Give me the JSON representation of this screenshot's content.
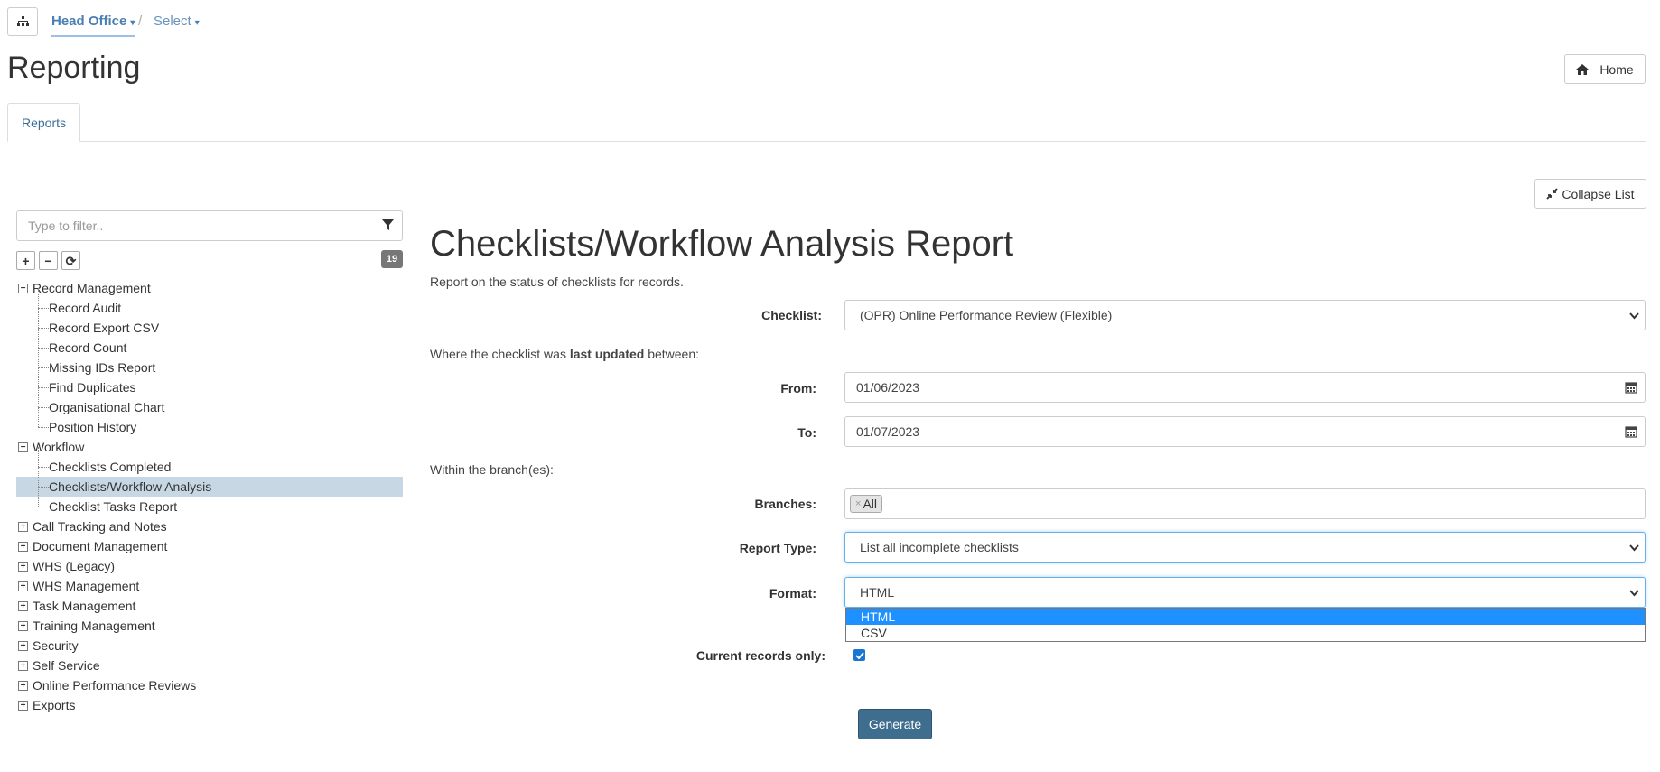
{
  "breadcrumb": {
    "org_icon": "sitemap-icon",
    "current": "Head Office",
    "separator": "/",
    "select_label": "Select",
    "caret": "▾"
  },
  "page": {
    "title": "Reporting",
    "home_label": "Home",
    "home_icon": "home-icon"
  },
  "tabs": [
    {
      "label": "Reports",
      "active": true
    }
  ],
  "sidebar": {
    "collapse_label": "Collapse List",
    "filter_placeholder": "Type to filter..",
    "count": "19",
    "tools": [
      "+",
      "−",
      "⟳"
    ],
    "tree": [
      {
        "label": "Record Management",
        "expanded": true,
        "children": [
          {
            "label": "Record Audit"
          },
          {
            "label": "Record Export CSV"
          },
          {
            "label": "Record Count"
          },
          {
            "label": "Missing IDs Report"
          },
          {
            "label": "Find Duplicates"
          },
          {
            "label": "Organisational Chart"
          },
          {
            "label": "Position History"
          }
        ]
      },
      {
        "label": "Workflow",
        "expanded": true,
        "children": [
          {
            "label": "Checklists Completed"
          },
          {
            "label": "Checklists/Workflow Analysis",
            "selected": true
          },
          {
            "label": "Checklist Tasks Report"
          }
        ]
      },
      {
        "label": "Call Tracking and Notes",
        "expanded": false
      },
      {
        "label": "Document Management",
        "expanded": false
      },
      {
        "label": "WHS (Legacy)",
        "expanded": false
      },
      {
        "label": "WHS Management",
        "expanded": false
      },
      {
        "label": "Task Management",
        "expanded": false
      },
      {
        "label": "Training Management",
        "expanded": false
      },
      {
        "label": "Security",
        "expanded": false
      },
      {
        "label": "Self Service",
        "expanded": false
      },
      {
        "label": "Online Performance Reviews",
        "expanded": false
      },
      {
        "label": "Exports",
        "expanded": false
      }
    ]
  },
  "report": {
    "title": "Checklists/Workflow Analysis Report",
    "description": "Report on the status of checklists for records.",
    "checklist_label": "Checklist:",
    "checklist_value": "(OPR) Online Performance Review (Flexible)",
    "last_updated_pre": "Where the checklist was ",
    "last_updated_bold": "last updated",
    "last_updated_post": " between:",
    "from_label": "From:",
    "from_value": "01/06/2023",
    "to_label": "To:",
    "to_value": "01/07/2023",
    "branch_text": "Within the branch(es):",
    "branches_label": "Branches:",
    "branch_tag": "All",
    "branch_tag_remove": "×",
    "report_type_label": "Report Type:",
    "report_type_value": "List all incomplete checklists",
    "format_label": "Format:",
    "format_value": "HTML",
    "format_options": [
      "HTML",
      "CSV"
    ],
    "current_only_label": "Current records only:",
    "current_only_checked": true,
    "generate_label": "Generate"
  },
  "colors": {
    "accent": "#3e6d8e",
    "link": "#4a7fb5",
    "selected_row": "#c7d8e4",
    "option_highlight": "#1e90ff"
  }
}
